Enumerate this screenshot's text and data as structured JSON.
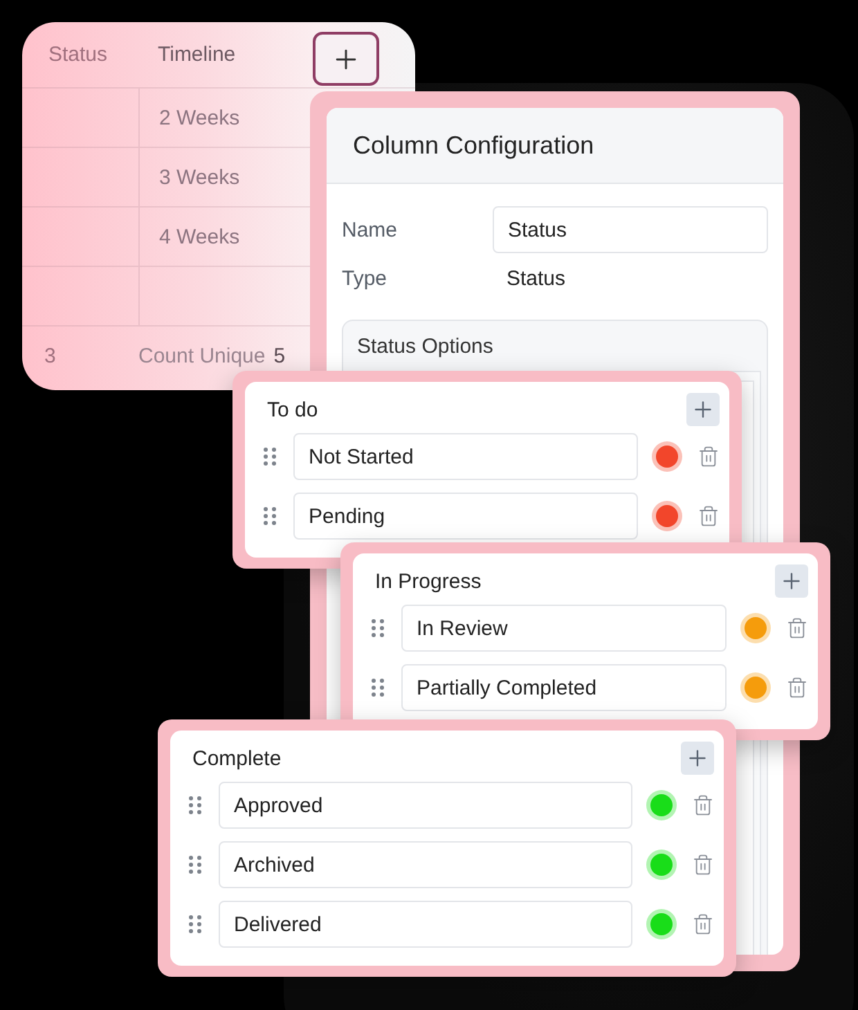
{
  "table": {
    "columns": [
      "Status",
      "Timeline"
    ],
    "rows": [
      {
        "timeline": "2 Weeks"
      },
      {
        "timeline": "3 Weeks"
      },
      {
        "timeline": "4 Weeks"
      }
    ],
    "footer": {
      "column_1": "3",
      "label": "Count Unique",
      "value": "5"
    }
  },
  "column_configuration": {
    "title": "Column Configuration",
    "fields": [
      {
        "label": "Name",
        "value": "Status",
        "kind": "input"
      },
      {
        "label": "Type",
        "value": "Status",
        "kind": "text"
      }
    ],
    "status_options": {
      "title": "Status Options",
      "groups": [
        {
          "title": "To do",
          "options": [
            {
              "name": "Not Started",
              "color": "#f2462b"
            },
            {
              "name": "Pending",
              "color": "#f2462b"
            }
          ]
        },
        {
          "title": "In Progress",
          "options": [
            {
              "name": "In Review",
              "color": "#f59c0c"
            },
            {
              "name": "Partially Completed",
              "color": "#f59c0c"
            }
          ]
        },
        {
          "title": "Complete",
          "options": [
            {
              "name": "Approved",
              "color": "#19dd19"
            },
            {
              "name": "Archived",
              "color": "#19dd19"
            },
            {
              "name": "Delivered",
              "color": "#19dd19"
            }
          ]
        }
      ]
    }
  }
}
